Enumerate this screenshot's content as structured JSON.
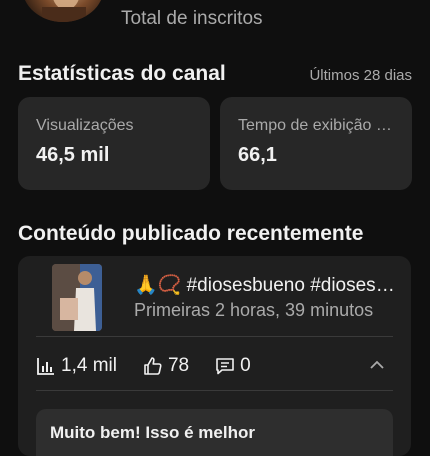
{
  "header": {
    "subscribers_label": "Total de inscritos"
  },
  "channel_stats": {
    "title": "Estatísticas do canal",
    "period": "Últimos 28 dias",
    "cards": [
      {
        "label": "Visualizações",
        "value": "46,5 mil"
      },
      {
        "label": "Tempo de exibição (horas)",
        "value": "66,1"
      }
    ]
  },
  "recent_content": {
    "title": "Conteúdo publicado recentemente",
    "video": {
      "title": "🙏📿 #diosesbueno #diosesamor",
      "meta": "Primeiras 2 horas, 39 minutos",
      "views": "1,4 mil",
      "likes": "78",
      "comments": "0"
    },
    "lower_panel_text": "Muito bem! Isso é melhor"
  },
  "icons": [
    "bar-chart-icon",
    "thumbs-up-icon",
    "comment-icon",
    "chevron-up-icon"
  ]
}
